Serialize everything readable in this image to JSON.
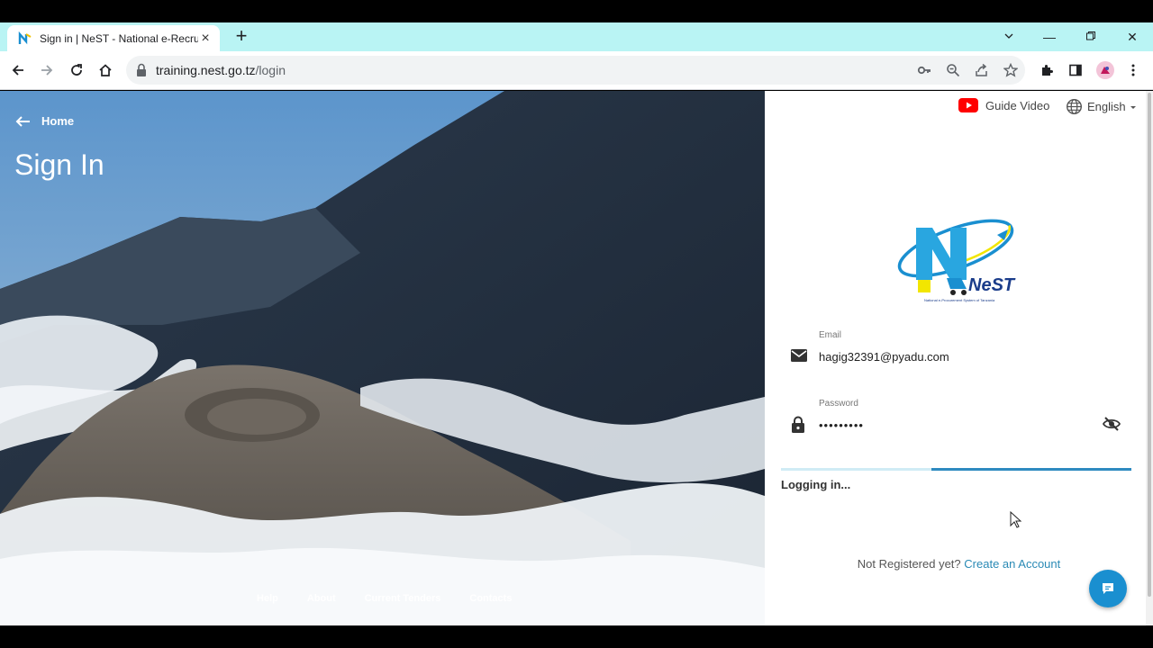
{
  "browser": {
    "tab_title": "Sign in | NeST - National e-Recru",
    "url_host": "training.nest.go.tz",
    "url_path": "/login",
    "new_tab": "+",
    "minimize": "—",
    "close": "✕",
    "tab_close": "×"
  },
  "hero": {
    "home_label": "Home",
    "title": "Sign In",
    "footer_links": [
      "Help",
      "About",
      "Current Tenders",
      "Contacts"
    ]
  },
  "panel": {
    "guide_video": "Guide Video",
    "language": "English",
    "logo_text": "NeST",
    "logo_tagline": "National e-Procurement System of Tanzania",
    "email_label": "Email",
    "email_value": "hagig32391@pyadu.com",
    "password_label": "Password",
    "password_value": "•••••••••",
    "progress": 0.57,
    "status": "Logging in...",
    "register_prompt": "Not Registered yet?",
    "register_link": "Create an Account"
  },
  "colors": {
    "tabstrip": "#b9f4f4",
    "accent": "#2e8ac0",
    "link": "#2a8ab5",
    "fab": "#1a8fd0",
    "youtube": "#ff0000"
  }
}
